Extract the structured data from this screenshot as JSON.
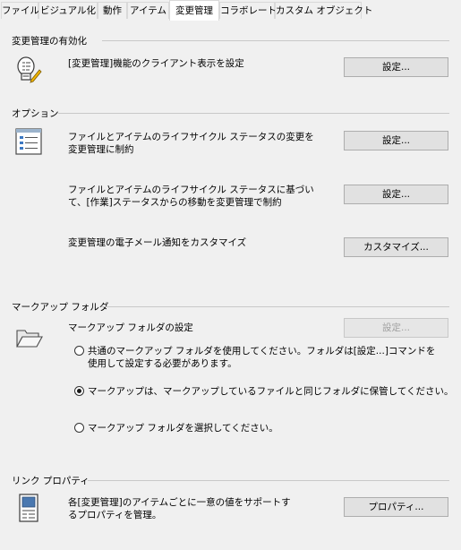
{
  "tabs": [
    {
      "label": "ファイル"
    },
    {
      "label": "ビジュアル化"
    },
    {
      "label": "動作"
    },
    {
      "label": "アイテム"
    },
    {
      "label": "変更管理",
      "active": true
    },
    {
      "label": "コラボレート"
    },
    {
      "label": "カスタム オブジェクト"
    }
  ],
  "sections": {
    "enable": {
      "title": "変更管理の有効化",
      "icon": "checklist-pencil-icon",
      "description": "[変更管理]機能のクライアント表示を設定",
      "button": "設定..."
    },
    "options": {
      "title": "オプション",
      "icon": "list-window-icon",
      "item1": {
        "line1": "ファイルとアイテムのライフサイクル ステータスの変更を",
        "line2": "変更管理に制約",
        "button": "設定..."
      },
      "item2": {
        "line1": "ファイルとアイテムのライフサイクル ステータスに基づい",
        "line2": "て、[作業]ステータスからの移動を変更管理で制約",
        "button": "設定..."
      },
      "item3": {
        "line1": "変更管理の電子メール通知をカスタマイズ",
        "button": "カスタマイズ..."
      }
    },
    "markup": {
      "title": "マークアップ フォルダ",
      "icon": "open-folder-icon",
      "settings_label": "マークアップ フォルダの設定",
      "button": "設定...",
      "button_disabled": true,
      "options": [
        {
          "line1": "共通のマークアップ フォルダを使用してください。フォルダは[設定...]コマンドを",
          "line2": "使用して設定する必要があります。",
          "selected": false
        },
        {
          "line1": "マークアップは、マークアップしているファイルと同じフォルダに保管してください。",
          "selected": true
        },
        {
          "line1": "マークアップ フォルダを選択してください。",
          "selected": false
        }
      ]
    },
    "link": {
      "title": "リンク プロパティ",
      "icon": "property-sheet-icon",
      "line1": "各[変更管理]のアイテムごとに一意の値をサポートす",
      "line2": "るプロパティを管理。",
      "button": "プロパティ..."
    }
  }
}
